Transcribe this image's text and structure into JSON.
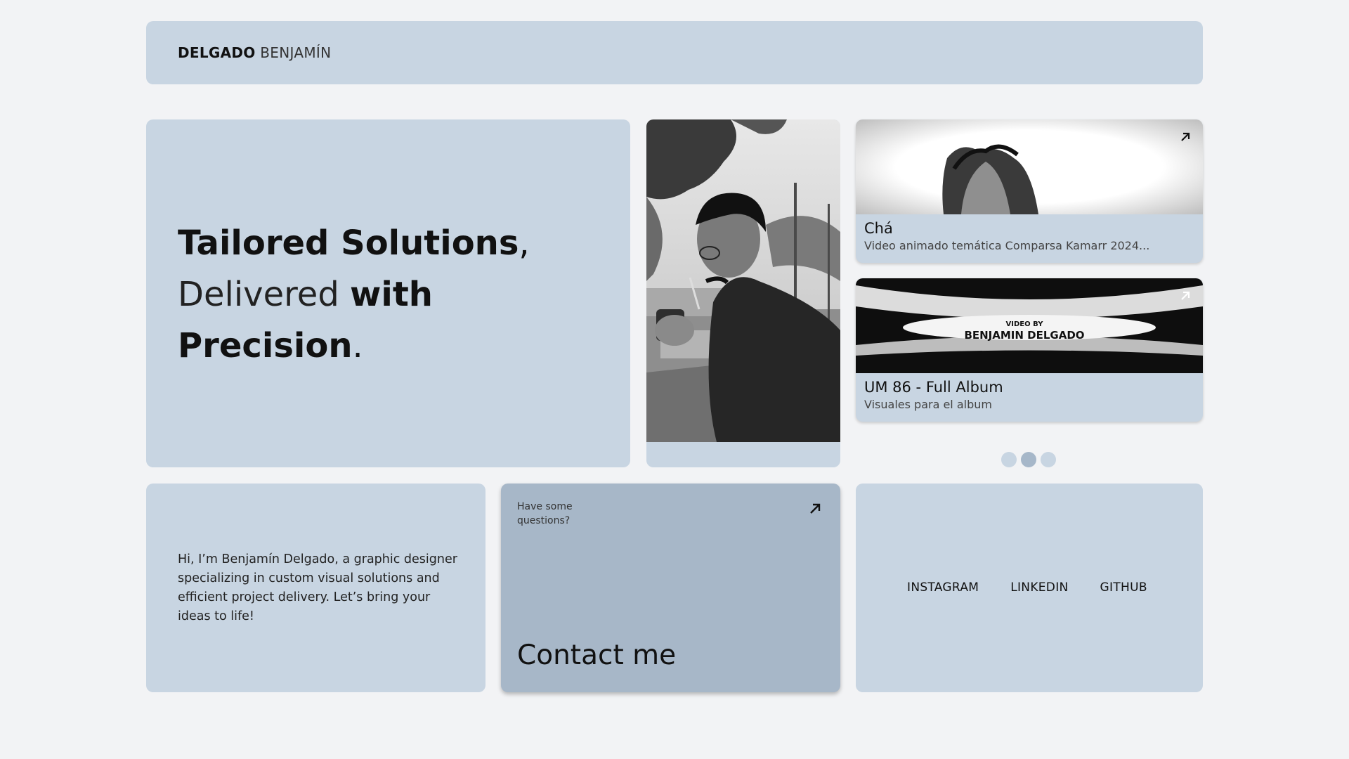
{
  "header": {
    "logo_first": "DELGADO",
    "logo_last": "BENJAMÍN"
  },
  "hero": {
    "line1_bold": "Tailored Solutions",
    "line1_comma": ",",
    "line2_light": "Delivered",
    "line2_bold": "with",
    "line3_bold": "Precision",
    "line3_dot": "."
  },
  "projects": [
    {
      "title": "Chá",
      "description": "Video animado temática Comparsa Kamarr 2024...",
      "icon": "arrow-up-right-icon"
    },
    {
      "title": "UM 86 - Full Album",
      "description": "Visuales para el album",
      "thumb_overlay_line1": "VIDEO BY",
      "thumb_overlay_line2": "BENJAMIN DELGADO",
      "icon": "arrow-up-right-icon"
    }
  ],
  "carousel": {
    "count": 3,
    "active_index": 1
  },
  "bio": {
    "text": "Hi, I’m Benjamín Delgado, a graphic designer specializing in custom visual solutions and efficient project delivery. Let’s bring your ideas to life!"
  },
  "contact": {
    "question": "Have some questions?",
    "title": "Contact me",
    "icon": "arrow-up-right-icon"
  },
  "social": {
    "links": [
      "INSTAGRAM",
      "LINKEDIN",
      "GITHUB"
    ]
  },
  "colors": {
    "page_bg": "#f2f3f5",
    "card_bg": "#c8d5e2",
    "contact_bg": "#a7b7c8",
    "dot_active": "#a6b7c9"
  }
}
